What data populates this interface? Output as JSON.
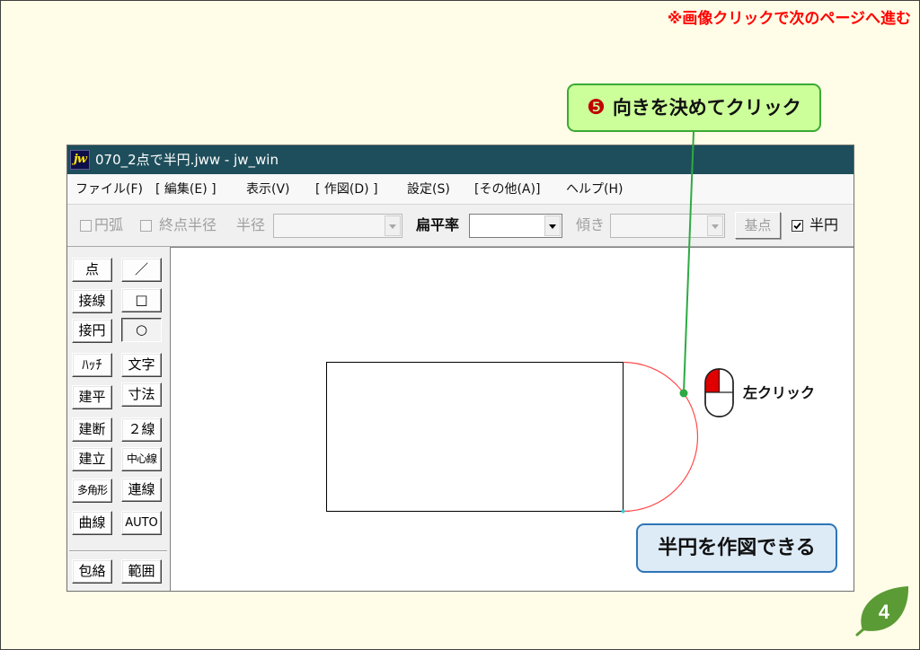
{
  "page": {
    "nav_hint": "※画像クリックで次のページへ進む",
    "page_number": "4"
  },
  "callouts": {
    "step_number": "❺",
    "step_text": "向きを決めてクリック",
    "mouse_action": "左クリック",
    "result_text": "半円を作図できる"
  },
  "window": {
    "app_icon_text": "jw",
    "title": "070_2点で半円.jww - jw_win"
  },
  "menu": [
    "ファイル(F)",
    "[ 編集(E) ]",
    "表示(V)",
    "[ 作図(D) ]",
    "設定(S)",
    "[その他(A)]",
    "ヘルプ(H)"
  ],
  "toolbar": {
    "arc": {
      "label": "円弧",
      "checked": false,
      "disabled": true
    },
    "end_radius": {
      "label": "終点半径",
      "checked": false,
      "disabled": true
    },
    "radius": {
      "label": "半径",
      "value": "",
      "disabled": true
    },
    "flatness": {
      "label": "扁平率",
      "value": "",
      "disabled": false
    },
    "tilt": {
      "label": "傾き",
      "value": "",
      "disabled": true
    },
    "base_point": {
      "label": "基点",
      "disabled": true
    },
    "semicircle": {
      "label": "半円",
      "checked": true,
      "disabled": false
    }
  },
  "tools": {
    "left": [
      {
        "label": "点"
      },
      {
        "label": "接線"
      },
      {
        "label": "接円"
      },
      {
        "label": "ﾊｯﾁ"
      },
      {
        "label": "建平"
      },
      {
        "label": "建断"
      },
      {
        "label": "建立"
      },
      {
        "label": "多角形"
      },
      {
        "label": "曲線"
      },
      {
        "label": "包絡"
      }
    ],
    "right": [
      {
        "label": "／"
      },
      {
        "label": "□"
      },
      {
        "label": "○",
        "pressed": true
      },
      {
        "label": "文字"
      },
      {
        "label": "寸法"
      },
      {
        "label": "２線"
      },
      {
        "label": "中心線"
      },
      {
        "label": "連線"
      },
      {
        "label": "AUTO"
      },
      {
        "label": "範囲"
      }
    ]
  },
  "icons": {
    "app": "jw-app-icon",
    "dropdown": "dropdown-arrow-icon",
    "checkbox_check": "checkmark-icon",
    "mouse": "mouse-left-click-icon",
    "page_badge": "leaf-icon"
  },
  "colors": {
    "slide_bg": "#FFFDE7",
    "nav_hint": "#FF0000",
    "titlebar": "#1E4E5B",
    "step_box_bg": "#CCFF99",
    "step_box_border": "#3AAA35",
    "step_number": "#C00000",
    "result_box_bg": "#DDEBF7",
    "result_box_border": "#2E75B6",
    "leader": "#2EAA44",
    "arc": "#FF4A4A",
    "snap_point": "#33CCDD",
    "mouse_button": "#E00000",
    "page_leaf": "#5B9B35"
  }
}
